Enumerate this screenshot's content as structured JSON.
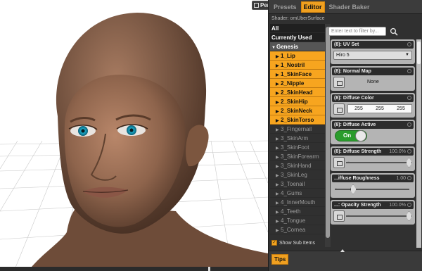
{
  "viewport": {
    "camera_button_label": "Pers"
  },
  "panel": {
    "tabs": [
      {
        "label": "Presets",
        "active": false
      },
      {
        "label": "Editor",
        "active": true
      },
      {
        "label": "Shader Baker",
        "active": false
      }
    ],
    "shader_label": "Shader: omUberSurface",
    "filter_placeholder": "Enter text to filter by...",
    "list": [
      {
        "label": "All",
        "kind": "header"
      },
      {
        "label": "Currently Used",
        "kind": "header"
      },
      {
        "label": "Genesis",
        "kind": "group"
      },
      {
        "label": "1_Lip",
        "kind": "sel"
      },
      {
        "label": "1_Nostril",
        "kind": "sel"
      },
      {
        "label": "1_SkinFace",
        "kind": "sel"
      },
      {
        "label": "2_Nipple",
        "kind": "sel"
      },
      {
        "label": "2_SkinHead",
        "kind": "sel"
      },
      {
        "label": "2_SkinHip",
        "kind": "sel"
      },
      {
        "label": "2_SkinNeck",
        "kind": "sel"
      },
      {
        "label": "2_SkinTorso",
        "kind": "sel"
      },
      {
        "label": "3_Fingernail",
        "kind": "item"
      },
      {
        "label": "3_SkinArm",
        "kind": "item"
      },
      {
        "label": "3_SkinFoot",
        "kind": "item"
      },
      {
        "label": "3_SkinForearm",
        "kind": "item"
      },
      {
        "label": "3_SkinHand",
        "kind": "item"
      },
      {
        "label": "3_SkinLeg",
        "kind": "item"
      },
      {
        "label": "3_Toenail",
        "kind": "item"
      },
      {
        "label": "4_Gums",
        "kind": "item"
      },
      {
        "label": "4_InnerMouth",
        "kind": "item"
      },
      {
        "label": "4_Teeth",
        "kind": "item"
      },
      {
        "label": "4_Tongue",
        "kind": "item"
      },
      {
        "label": "5_Cornea",
        "kind": "item"
      }
    ],
    "show_sub_items": {
      "label": "Show Sub Items",
      "checked": true
    },
    "properties": {
      "uv_set": {
        "title": "(8): UV Set",
        "value": "Hiro 5"
      },
      "normal_map": {
        "title": "(8): Normal Map",
        "value": "None"
      },
      "diffuse_color": {
        "title": "(8): Diffuse Color",
        "r": "255",
        "g": "255",
        "b": "255"
      },
      "diffuse_active": {
        "title": "(8): Diffuse Active",
        "value": "On"
      },
      "diffuse_strength": {
        "title": "(8): Diffuse Strength",
        "value": "100.0%",
        "minus": "-",
        "level": 1.0
      },
      "diffuse_roughness": {
        "title": "...iffuse Roughness",
        "value": "1.00",
        "minus": "-",
        "level": 0.25
      },
      "opacity_strength": {
        "title": "...: Opacity Strength",
        "value": "100.0%",
        "minus": "-",
        "level": 1.0
      }
    },
    "tips_label": "Tips"
  }
}
